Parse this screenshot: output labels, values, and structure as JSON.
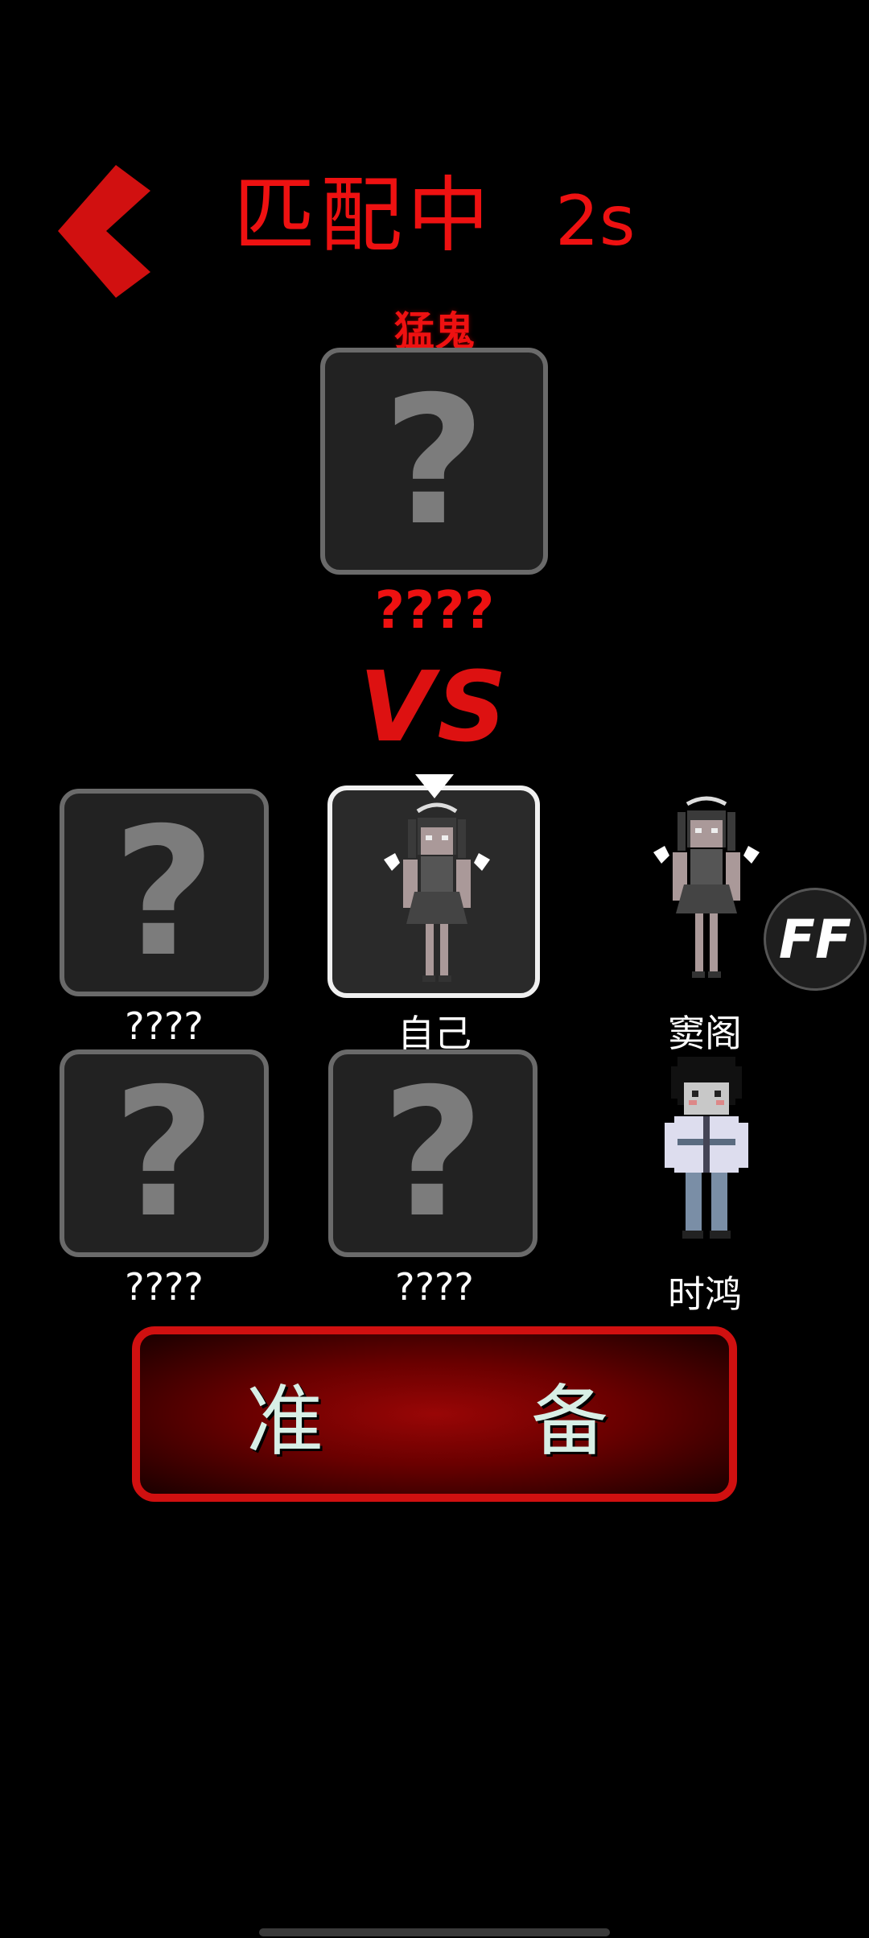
{
  "header": {
    "title": "匹配中",
    "timer": "2s"
  },
  "ghost": {
    "role_label": "猛鬼",
    "slot_placeholder": "?",
    "name": "????"
  },
  "versus_text": "VS",
  "team": {
    "slots": [
      {
        "placeholder": "?",
        "name": "????"
      },
      {
        "name": "自己"
      },
      {
        "placeholder": "?",
        "name": "????"
      },
      {
        "placeholder": "?",
        "name": "????"
      }
    ],
    "roster": [
      {
        "name": "窦阁"
      },
      {
        "name": "时鸿"
      }
    ]
  },
  "ff_button": "FF",
  "ready_button": {
    "left": "准",
    "right": "备"
  },
  "colors": {
    "accent": "#e11111",
    "slot_bg": "#222222",
    "slot_border": "#6a6a6a"
  }
}
